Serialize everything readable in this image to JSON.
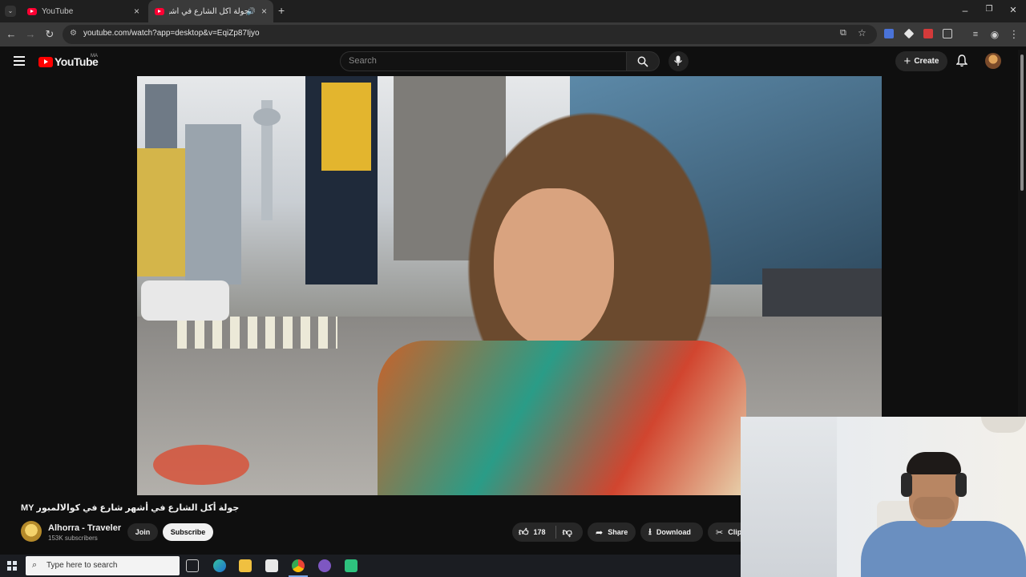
{
  "browser": {
    "tabs": [
      {
        "title": "YouTube"
      },
      {
        "title": "جولة أكل الشارع في أشهر شا"
      }
    ],
    "new_tab": "+",
    "url": "youtube.com/watch?app=desktop&v=EqiZp87Ijyo",
    "window_controls": {
      "minimize": "–",
      "maximize": "❐",
      "close": "✕"
    }
  },
  "youtube": {
    "logo_text": "YouTube",
    "region": "MA",
    "search_placeholder": "Search",
    "create_label": "Create"
  },
  "video": {
    "title": "جولة أكل الشارع في أشهر شارع في كوالالمبور MY",
    "channel_name": "Alhorra - Traveler",
    "subscribers": "153K subscribers",
    "join_label": "Join",
    "subscribe_label": "Subscribe",
    "likes": "178",
    "share_label": "Share",
    "download_label": "Download",
    "clip_label": "Clip"
  },
  "taskbar": {
    "search_placeholder": "Type here to search"
  },
  "colors": {
    "yt_red": "#ff0000",
    "background": "#0f0f0f",
    "chrome_bar": "#3a3a3a"
  }
}
